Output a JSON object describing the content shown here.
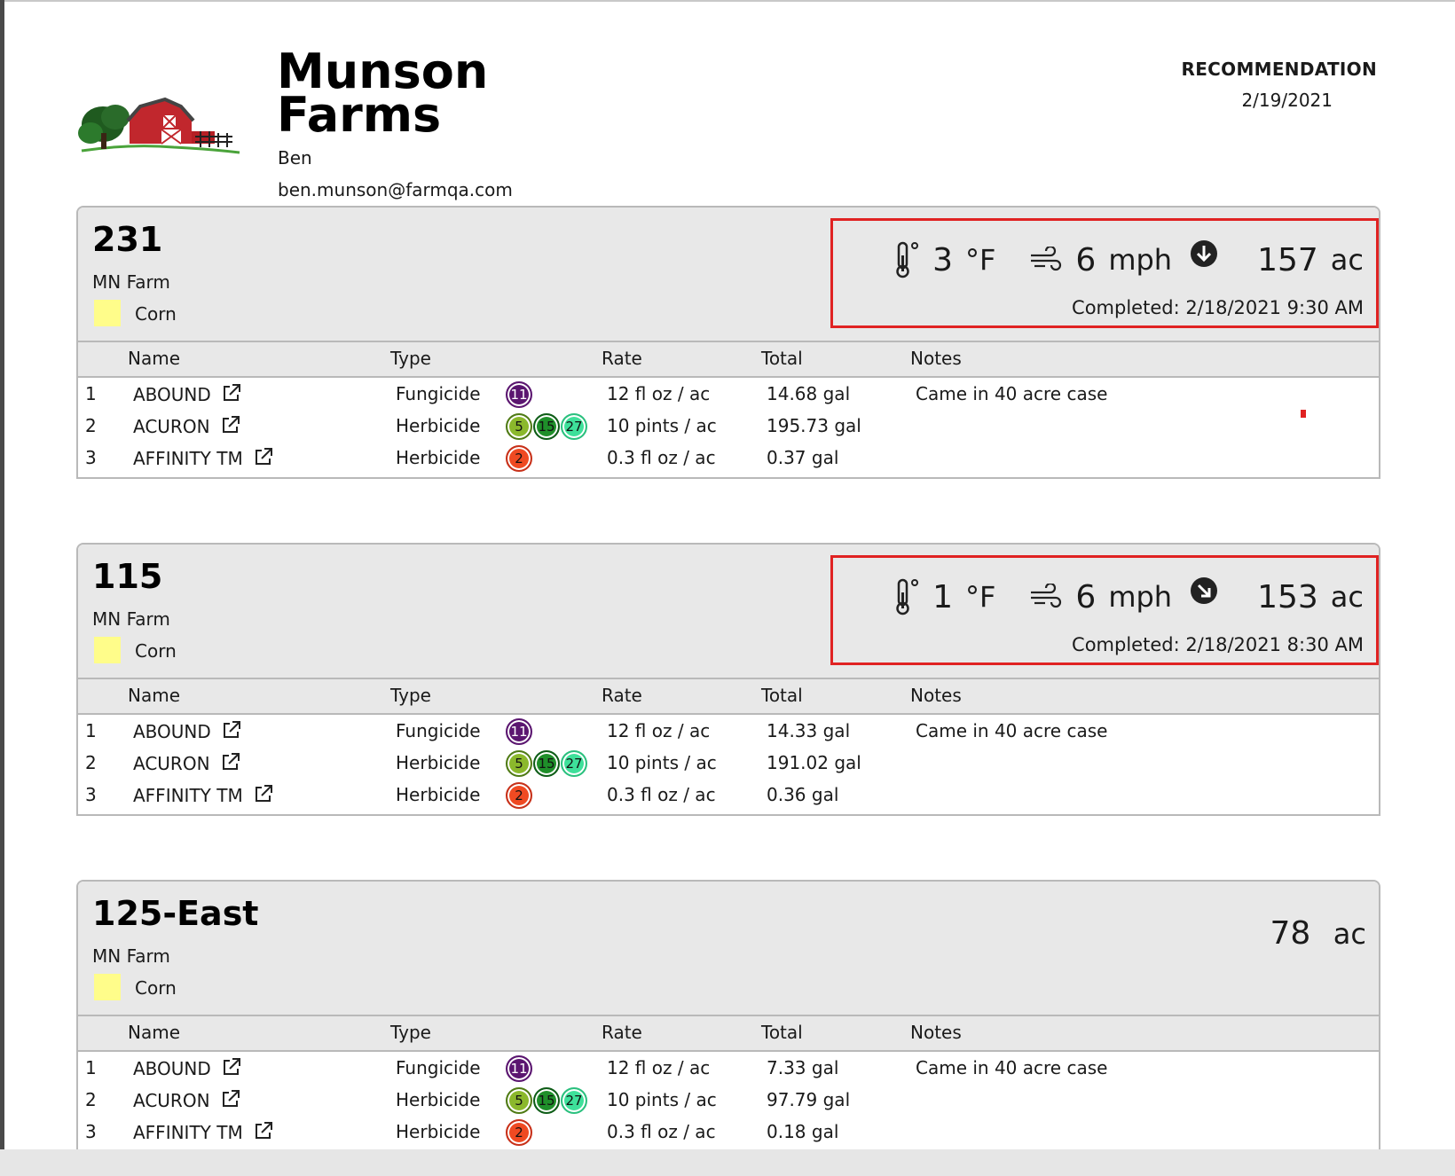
{
  "header": {
    "farm_name": "Munson Farms",
    "user_name": "Ben",
    "user_email": "ben.munson@farmqa.com",
    "doc_type": "RECOMMENDATION",
    "doc_date": "2/19/2021"
  },
  "columns": {
    "name": "Name",
    "type": "Type",
    "rate": "Rate",
    "total": "Total",
    "notes": "Notes"
  },
  "fields": [
    {
      "name": "231",
      "farm": "MN Farm",
      "crop": "Corn",
      "crop_color": "#fffd8a",
      "weather": {
        "temp": "3",
        "temp_unit": "°F",
        "wind": "6",
        "wind_unit": "mph",
        "wind_dir_icon": "arrow-down-icon",
        "completed": "Completed: 2/18/2021 9:30 AM"
      },
      "acres": "157",
      "acres_unit": "ac",
      "rows": [
        {
          "num": "1",
          "name": "ABOUND",
          "type": "Fungicide",
          "badges": [
            {
              "label": "11",
              "color": "#5b1670"
            }
          ],
          "rate": "12 fl oz / ac",
          "total": "14.68 gal",
          "notes": "Came in 40 acre case"
        },
        {
          "num": "2",
          "name": "ACURON",
          "type": "Herbicide",
          "badges": [
            {
              "label": "5",
              "color": "#8bb82c"
            },
            {
              "label": "15",
              "color": "#1f8f2a"
            },
            {
              "label": "27",
              "color": "#3ee09a"
            }
          ],
          "rate": "10 pints / ac",
          "total": "195.73 gal",
          "notes": ""
        },
        {
          "num": "3",
          "name": "AFFINITY TM",
          "type": "Herbicide",
          "badges": [
            {
              "label": "2",
              "color": "#ef4a22"
            }
          ],
          "rate": "0.3 fl oz / ac",
          "total": "0.37 gal",
          "notes": ""
        }
      ]
    },
    {
      "name": "115",
      "farm": "MN Farm",
      "crop": "Corn",
      "crop_color": "#fffd8a",
      "weather": {
        "temp": "1",
        "temp_unit": "°F",
        "wind": "6",
        "wind_unit": "mph",
        "wind_dir_icon": "arrow-down-right-icon",
        "completed": "Completed: 2/18/2021 8:30 AM"
      },
      "acres": "153",
      "acres_unit": "ac",
      "rows": [
        {
          "num": "1",
          "name": "ABOUND",
          "type": "Fungicide",
          "badges": [
            {
              "label": "11",
              "color": "#5b1670"
            }
          ],
          "rate": "12 fl oz / ac",
          "total": "14.33 gal",
          "notes": "Came in 40 acre case"
        },
        {
          "num": "2",
          "name": "ACURON",
          "type": "Herbicide",
          "badges": [
            {
              "label": "5",
              "color": "#8bb82c"
            },
            {
              "label": "15",
              "color": "#1f8f2a"
            },
            {
              "label": "27",
              "color": "#3ee09a"
            }
          ],
          "rate": "10 pints / ac",
          "total": "191.02 gal",
          "notes": ""
        },
        {
          "num": "3",
          "name": "AFFINITY TM",
          "type": "Herbicide",
          "badges": [
            {
              "label": "2",
              "color": "#ef4a22"
            }
          ],
          "rate": "0.3 fl oz / ac",
          "total": "0.36 gal",
          "notes": ""
        }
      ]
    },
    {
      "name": "125-East",
      "farm": "MN Farm",
      "crop": "Corn",
      "crop_color": "#fffd8a",
      "acres": "78",
      "acres_unit": "ac",
      "rows": [
        {
          "num": "1",
          "name": "ABOUND",
          "type": "Fungicide",
          "badges": [
            {
              "label": "11",
              "color": "#5b1670"
            }
          ],
          "rate": "12 fl oz / ac",
          "total": "7.33 gal",
          "notes": "Came in 40 acre case"
        },
        {
          "num": "2",
          "name": "ACURON",
          "type": "Herbicide",
          "badges": [
            {
              "label": "5",
              "color": "#8bb82c"
            },
            {
              "label": "15",
              "color": "#1f8f2a"
            },
            {
              "label": "27",
              "color": "#3ee09a"
            }
          ],
          "rate": "10 pints / ac",
          "total": "97.79 gal",
          "notes": ""
        },
        {
          "num": "3",
          "name": "AFFINITY TM",
          "type": "Herbicide",
          "badges": [
            {
              "label": "2",
              "color": "#ef4a22"
            }
          ],
          "rate": "0.3 fl oz / ac",
          "total": "0.18 gal",
          "notes": ""
        }
      ]
    }
  ],
  "colors": {
    "highlight_border": "#e02222",
    "header_bg": "#e8e8e8"
  }
}
